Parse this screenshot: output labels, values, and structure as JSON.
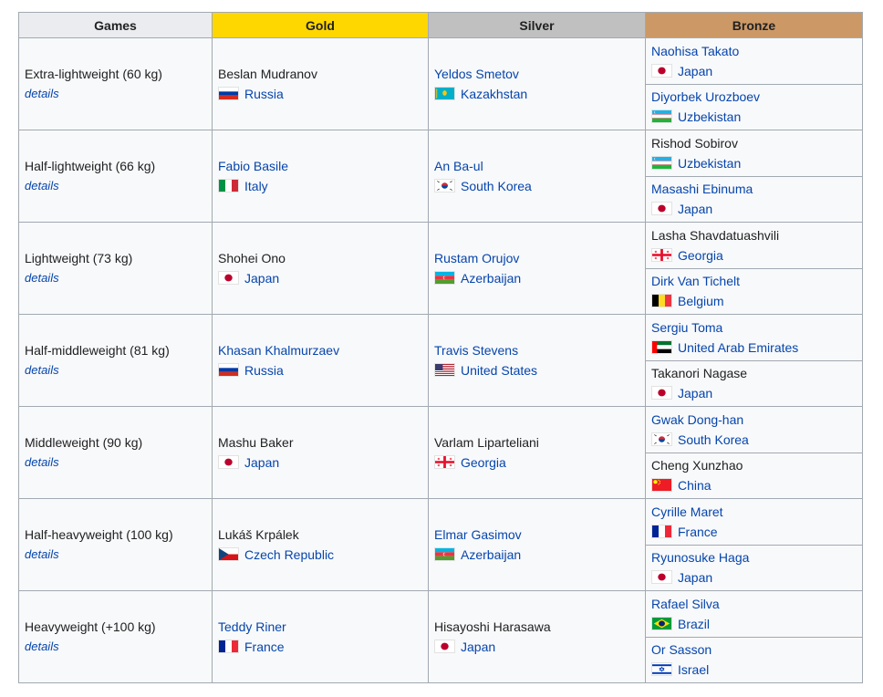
{
  "headers": {
    "games": "Games",
    "gold": "Gold",
    "silver": "Silver",
    "bronze": "Bronze"
  },
  "details_label": "details",
  "events": [
    {
      "name": "Extra-lightweight (60 kg)",
      "gold": {
        "athlete": "Beslan Mudranov",
        "linked": false,
        "country": "Russia",
        "flag": "russia-flag-icon"
      },
      "silver": {
        "athlete": "Yeldos Smetov",
        "linked": true,
        "country": "Kazakhstan",
        "flag": "kazakhstan-flag-icon"
      },
      "bronze": [
        {
          "athlete": "Naohisa Takato",
          "linked": true,
          "country": "Japan",
          "flag": "japan-flag-icon"
        },
        {
          "athlete": "Diyorbek Urozboev",
          "linked": true,
          "country": "Uzbekistan",
          "flag": "uzbekistan-flag-icon"
        }
      ]
    },
    {
      "name": "Half-lightweight (66 kg)",
      "gold": {
        "athlete": "Fabio Basile",
        "linked": true,
        "country": "Italy",
        "flag": "italy-flag-icon"
      },
      "silver": {
        "athlete": "An Ba-ul",
        "linked": true,
        "country": "South Korea",
        "flag": "south-korea-flag-icon"
      },
      "bronze": [
        {
          "athlete": "Rishod Sobirov",
          "linked": false,
          "country": "Uzbekistan",
          "flag": "uzbekistan-flag-icon"
        },
        {
          "athlete": "Masashi Ebinuma",
          "linked": true,
          "country": "Japan",
          "flag": "japan-flag-icon"
        }
      ]
    },
    {
      "name": "Lightweight (73 kg)",
      "gold": {
        "athlete": "Shohei Ono",
        "linked": false,
        "country": "Japan",
        "flag": "japan-flag-icon"
      },
      "silver": {
        "athlete": "Rustam Orujov",
        "linked": true,
        "country": "Azerbaijan",
        "flag": "azerbaijan-flag-icon"
      },
      "bronze": [
        {
          "athlete": "Lasha Shavdatuashvili",
          "linked": false,
          "country": "Georgia",
          "flag": "georgia-flag-icon"
        },
        {
          "athlete": "Dirk Van Tichelt",
          "linked": true,
          "country": "Belgium",
          "flag": "belgium-flag-icon"
        }
      ]
    },
    {
      "name": "Half-middleweight (81 kg)",
      "gold": {
        "athlete": "Khasan Khalmurzaev",
        "linked": true,
        "country": "Russia",
        "flag": "russia-flag-icon"
      },
      "silver": {
        "athlete": "Travis Stevens",
        "linked": true,
        "country": "United States",
        "flag": "united-states-flag-icon"
      },
      "bronze": [
        {
          "athlete": "Sergiu Toma",
          "linked": true,
          "country": "United Arab Emirates",
          "flag": "uae-flag-icon"
        },
        {
          "athlete": "Takanori Nagase",
          "linked": false,
          "country": "Japan",
          "flag": "japan-flag-icon"
        }
      ]
    },
    {
      "name": "Middleweight (90 kg)",
      "gold": {
        "athlete": "Mashu Baker",
        "linked": false,
        "country": "Japan",
        "flag": "japan-flag-icon"
      },
      "silver": {
        "athlete": "Varlam Liparteliani",
        "linked": false,
        "country": "Georgia",
        "flag": "georgia-flag-icon"
      },
      "bronze": [
        {
          "athlete": "Gwak Dong-han",
          "linked": true,
          "country": "South Korea",
          "flag": "south-korea-flag-icon"
        },
        {
          "athlete": "Cheng Xunzhao",
          "linked": false,
          "country": "China",
          "flag": "china-flag-icon"
        }
      ]
    },
    {
      "name": "Half-heavyweight (100 kg)",
      "gold": {
        "athlete": "Lukáš Krpálek",
        "linked": false,
        "country": "Czech Republic",
        "flag": "czech-republic-flag-icon"
      },
      "silver": {
        "athlete": "Elmar Gasimov",
        "linked": true,
        "country": "Azerbaijan",
        "flag": "azerbaijan-flag-icon"
      },
      "bronze": [
        {
          "athlete": "Cyrille Maret",
          "linked": true,
          "country": "France",
          "flag": "france-flag-icon"
        },
        {
          "athlete": "Ryunosuke Haga",
          "linked": true,
          "country": "Japan",
          "flag": "japan-flag-icon"
        }
      ]
    },
    {
      "name": "Heavyweight (+100 kg)",
      "gold": {
        "athlete": "Teddy Riner",
        "linked": true,
        "country": "France",
        "flag": "france-flag-icon"
      },
      "silver": {
        "athlete": "Hisayoshi Harasawa",
        "linked": false,
        "country": "Japan",
        "flag": "japan-flag-icon"
      },
      "bronze": [
        {
          "athlete": "Rafael Silva",
          "linked": true,
          "country": "Brazil",
          "flag": "brazil-flag-icon"
        },
        {
          "athlete": "Or Sasson",
          "linked": true,
          "country": "Israel",
          "flag": "israel-flag-icon"
        }
      ]
    }
  ],
  "colors": {
    "link": "#0645ad",
    "text": "#202122",
    "border": "#a2a9b1",
    "cell_bg": "#f8f9fa",
    "header_games": "#eaecf0",
    "header_gold": "#ffd700",
    "header_silver": "#c0c0c0",
    "header_bronze": "#cc9966"
  }
}
